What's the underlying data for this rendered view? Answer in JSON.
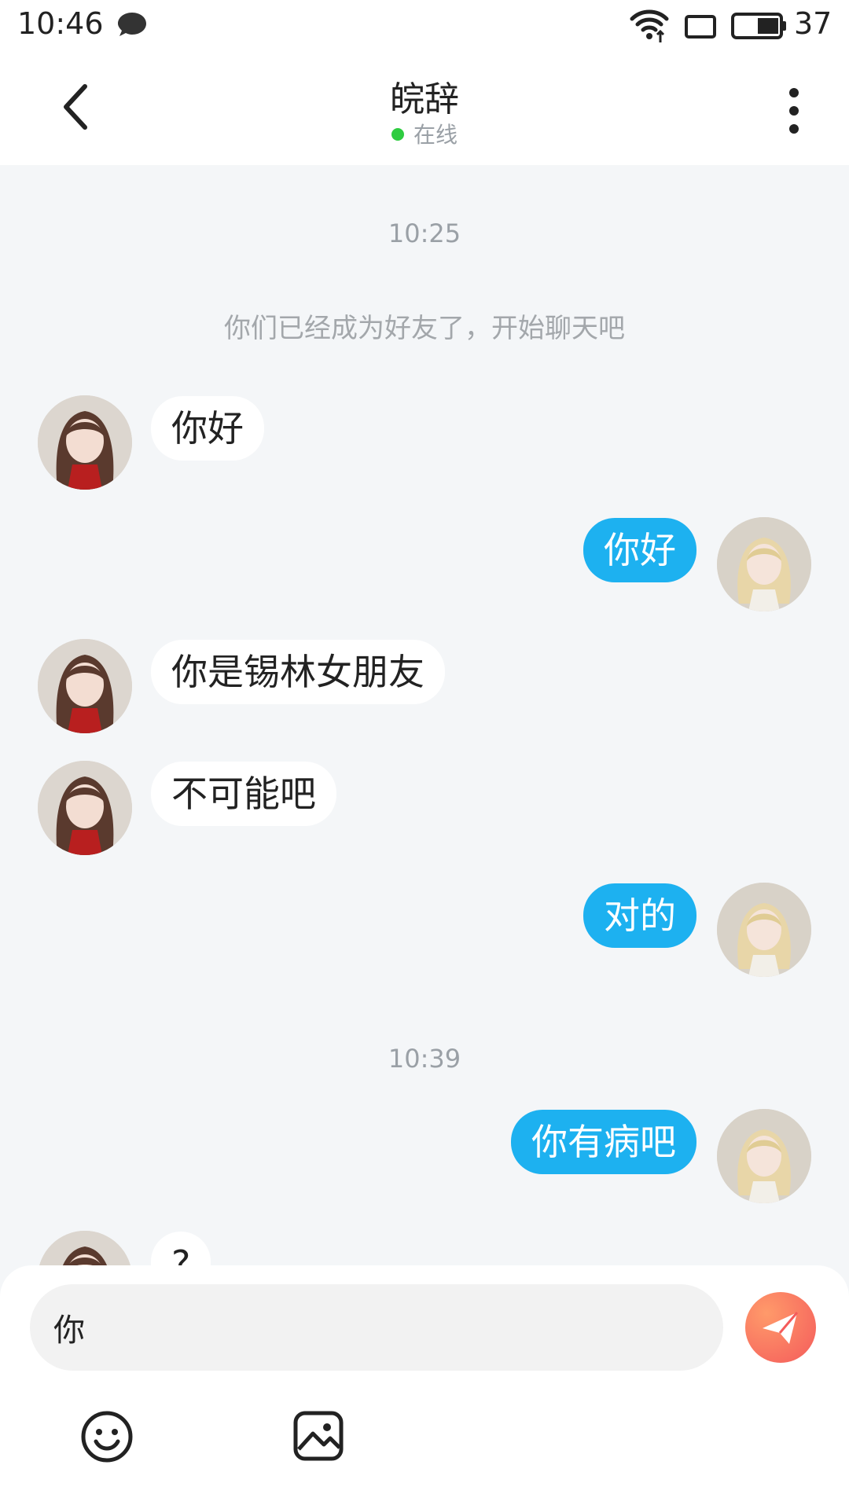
{
  "statusbar": {
    "time": "10:46",
    "battery": "37"
  },
  "header": {
    "title": "皖辞",
    "status": "在线"
  },
  "chat": {
    "timestamps": [
      "10:25",
      "10:39"
    ],
    "system_message": "你们已经成为好友了，开始聊天吧",
    "messages": [
      {
        "side": "in",
        "text": "你好"
      },
      {
        "side": "out",
        "text": "你好"
      },
      {
        "side": "in",
        "text": "你是锡林女朋友"
      },
      {
        "side": "in",
        "text": "不可能吧"
      },
      {
        "side": "out",
        "text": "对的"
      },
      {
        "side": "out",
        "text": "你有病吧"
      },
      {
        "side": "in",
        "text": "?"
      }
    ]
  },
  "input": {
    "value": "你"
  },
  "colors": {
    "outgoing_bubble": "#1db1f0",
    "incoming_bubble": "#ffffff",
    "background": "#f4f6f8",
    "online_dot": "#2ecc40",
    "send_button": "#f45b5b"
  },
  "icons": {
    "message": "chat-bubble-icon",
    "wifi": "wifi-icon",
    "screen": "screen-icon",
    "battery": "battery-icon",
    "back": "chevron-left-icon",
    "more": "more-vertical-icon",
    "send": "paper-plane-icon",
    "emoji": "emoji-icon",
    "image": "image-icon"
  }
}
